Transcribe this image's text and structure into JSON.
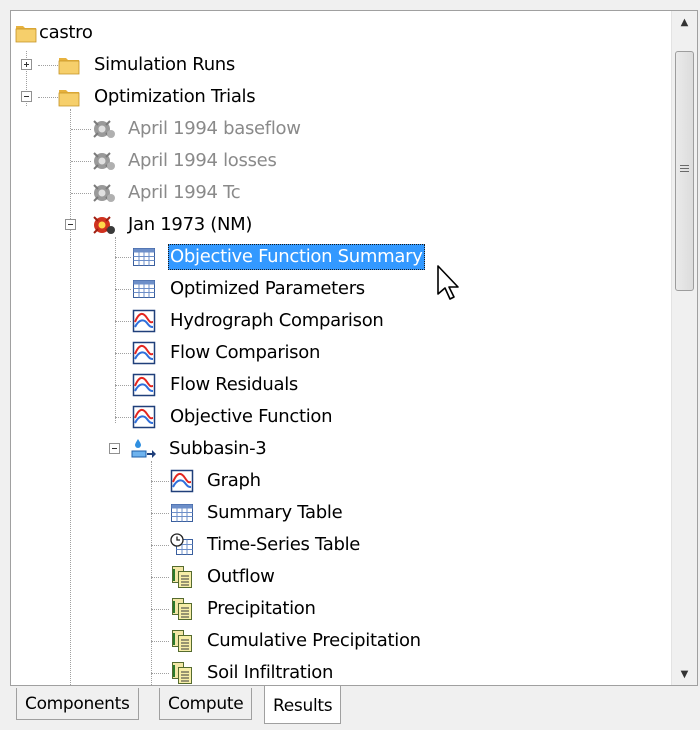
{
  "tree": {
    "root": {
      "label": "castro",
      "icon": "folder-icon"
    },
    "simulation_runs": {
      "label": "Simulation Runs",
      "icon": "folder-icon",
      "expanded": false
    },
    "optimization_trials": {
      "label": "Optimization Trials",
      "icon": "folder-icon",
      "expanded": true
    },
    "trials": [
      {
        "label": "April 1994 baseflow",
        "icon": "optimization-trial-icon",
        "status": "inactive"
      },
      {
        "label": "April 1994 losses",
        "icon": "optimization-trial-icon",
        "status": "inactive"
      },
      {
        "label": "April 1994 Tc",
        "icon": "optimization-trial-icon",
        "status": "inactive"
      },
      {
        "label": "Jan 1973 (NM)",
        "icon": "optimization-trial-active-icon",
        "status": "active"
      }
    ],
    "trial_results": [
      {
        "label": "Objective Function Summary",
        "icon": "table-icon",
        "selected": true
      },
      {
        "label": "Optimized Parameters",
        "icon": "table-icon"
      },
      {
        "label": "Hydrograph Comparison",
        "icon": "graph-icon"
      },
      {
        "label": "Flow Comparison",
        "icon": "graph-icon"
      },
      {
        "label": "Flow Residuals",
        "icon": "graph-icon"
      },
      {
        "label": "Objective Function",
        "icon": "graph-icon"
      }
    ],
    "subbasin": {
      "label": "Subbasin-3",
      "icon": "subbasin-icon",
      "expanded": true
    },
    "subbasin_results": [
      {
        "label": "Graph",
        "icon": "graph-icon"
      },
      {
        "label": "Summary Table",
        "icon": "table-icon"
      },
      {
        "label": "Time-Series Table",
        "icon": "time-series-table-icon"
      },
      {
        "label": "Outflow",
        "icon": "time-series-icon"
      },
      {
        "label": "Precipitation",
        "icon": "time-series-icon"
      },
      {
        "label": "Cumulative Precipitation",
        "icon": "time-series-icon"
      },
      {
        "label": "Soil Infiltration",
        "icon": "time-series-icon"
      }
    ]
  },
  "tabs": [
    {
      "label": "Components",
      "active": false
    },
    {
      "label": "Compute",
      "active": false
    },
    {
      "label": "Results",
      "active": true
    }
  ],
  "colors": {
    "selection": "#3399ff",
    "inactive_text": "#8a8a8a",
    "folder": "#f2c760",
    "graph_line_red": "#e4261f",
    "graph_line_blue": "#2f6fdb"
  }
}
